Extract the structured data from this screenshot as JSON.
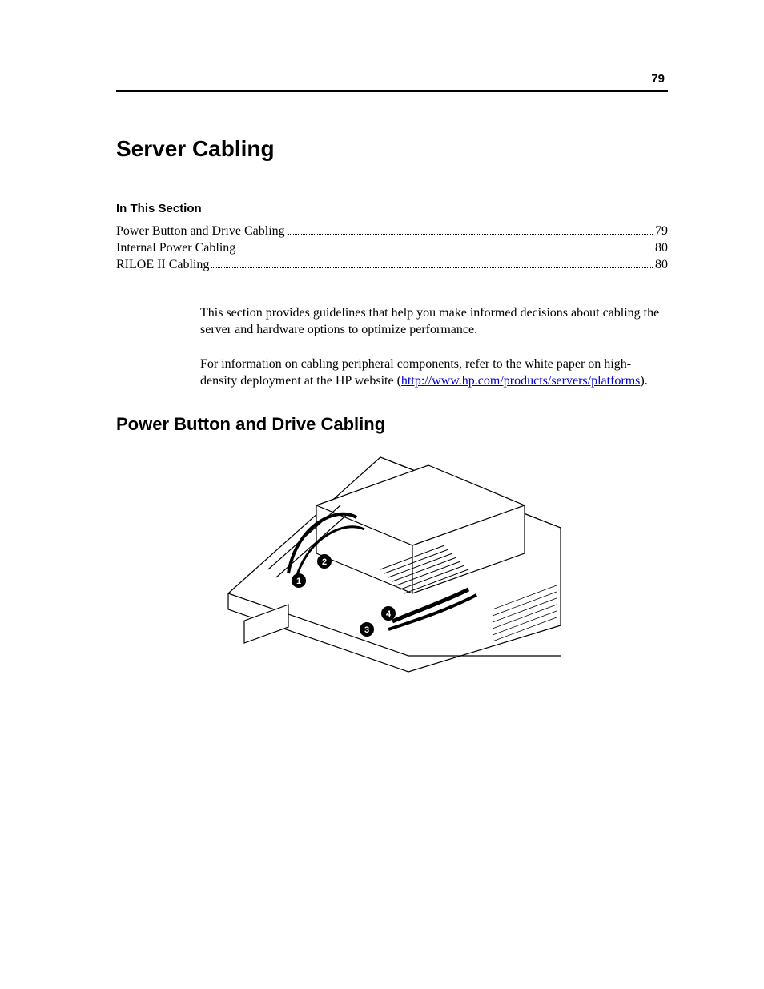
{
  "page_number": "79",
  "title": "Server Cabling",
  "section_label": "In This Section",
  "toc": [
    {
      "label": "Power Button and Drive Cabling",
      "page": "79"
    },
    {
      "label": "Internal Power Cabling",
      "page": "80"
    },
    {
      "label": "RILOE II Cabling",
      "page": "80"
    }
  ],
  "paragraphs": {
    "p1": "This section provides guidelines that help you make informed decisions about cabling the server and hardware options to optimize performance.",
    "p2_a": "For information on cabling peripheral components, refer to the white paper on high-density deployment at the HP website (",
    "p2_link": "http://www.hp.com/products/servers/platforms",
    "p2_b": ")."
  },
  "subheading": "Power Button and Drive Cabling",
  "figure": {
    "callouts": [
      "1",
      "2",
      "3",
      "4"
    ]
  }
}
